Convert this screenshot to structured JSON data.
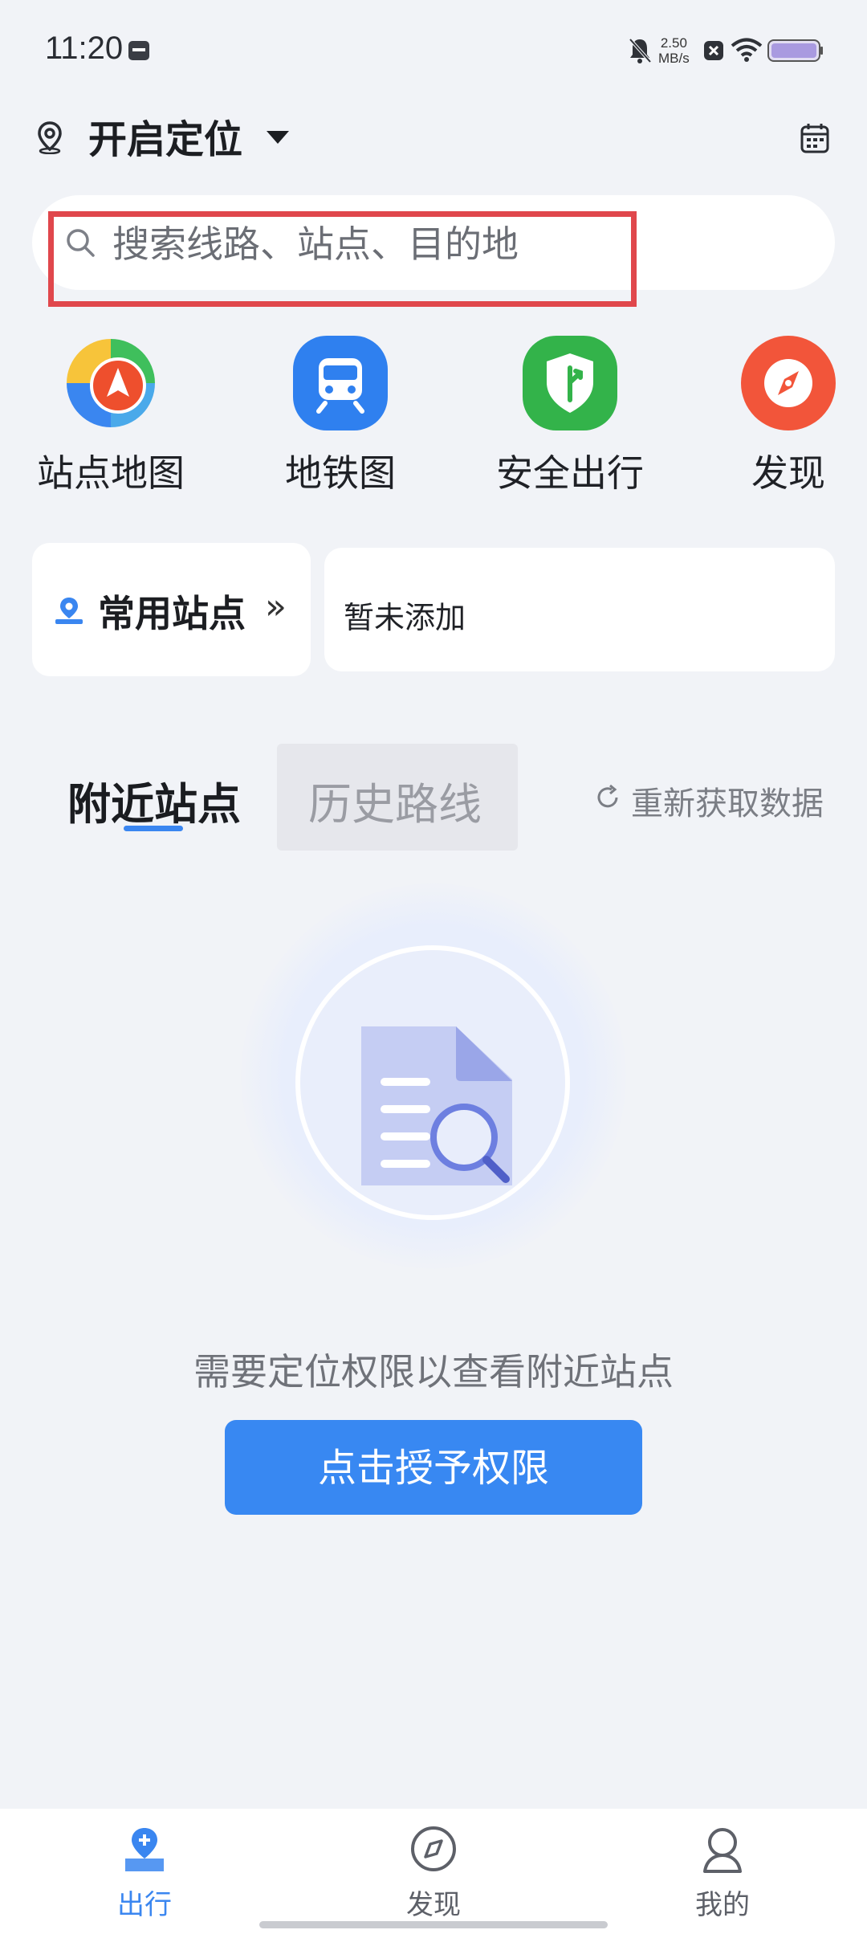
{
  "status_bar": {
    "time": "11:20",
    "net_speed_value": "2.50",
    "net_speed_unit": "MB/s",
    "icons": [
      "calendar-app-icon",
      "bell-muted-icon",
      "close-box-icon",
      "wifi-icon",
      "battery-icon"
    ]
  },
  "location": {
    "title": "开启定位",
    "icon": "location-pin-icon",
    "dropdown_icon": "caret-down-icon",
    "right_icon": "calendar-icon"
  },
  "search": {
    "placeholder": "搜索线路、站点、目的地",
    "icon": "search-icon"
  },
  "quick_actions": [
    {
      "label": "站点地图",
      "icon": "station-map-icon"
    },
    {
      "label": "地铁图",
      "icon": "metro-icon"
    },
    {
      "label": "安全出行",
      "icon": "safe-travel-icon"
    },
    {
      "label": "发现",
      "icon": "compass-icon"
    }
  ],
  "common_stations": {
    "label": "常用站点",
    "arrow": "»",
    "empty_text": "暂未添加"
  },
  "tabs": {
    "nearby": "附近站点",
    "history": "历史路线",
    "refresh": "重新获取数据"
  },
  "empty_state": {
    "message": "需要定位权限以查看附近站点",
    "button": "点击授予权限"
  },
  "bottom_nav": [
    {
      "label": "出行",
      "icon": "travel-icon",
      "active": true
    },
    {
      "label": "发现",
      "icon": "discover-icon",
      "active": false
    },
    {
      "label": "我的",
      "icon": "profile-icon",
      "active": false
    }
  ],
  "colors": {
    "accent": "#3a86f0",
    "background": "#f1f3f7",
    "highlight_box": "#e0474c"
  }
}
